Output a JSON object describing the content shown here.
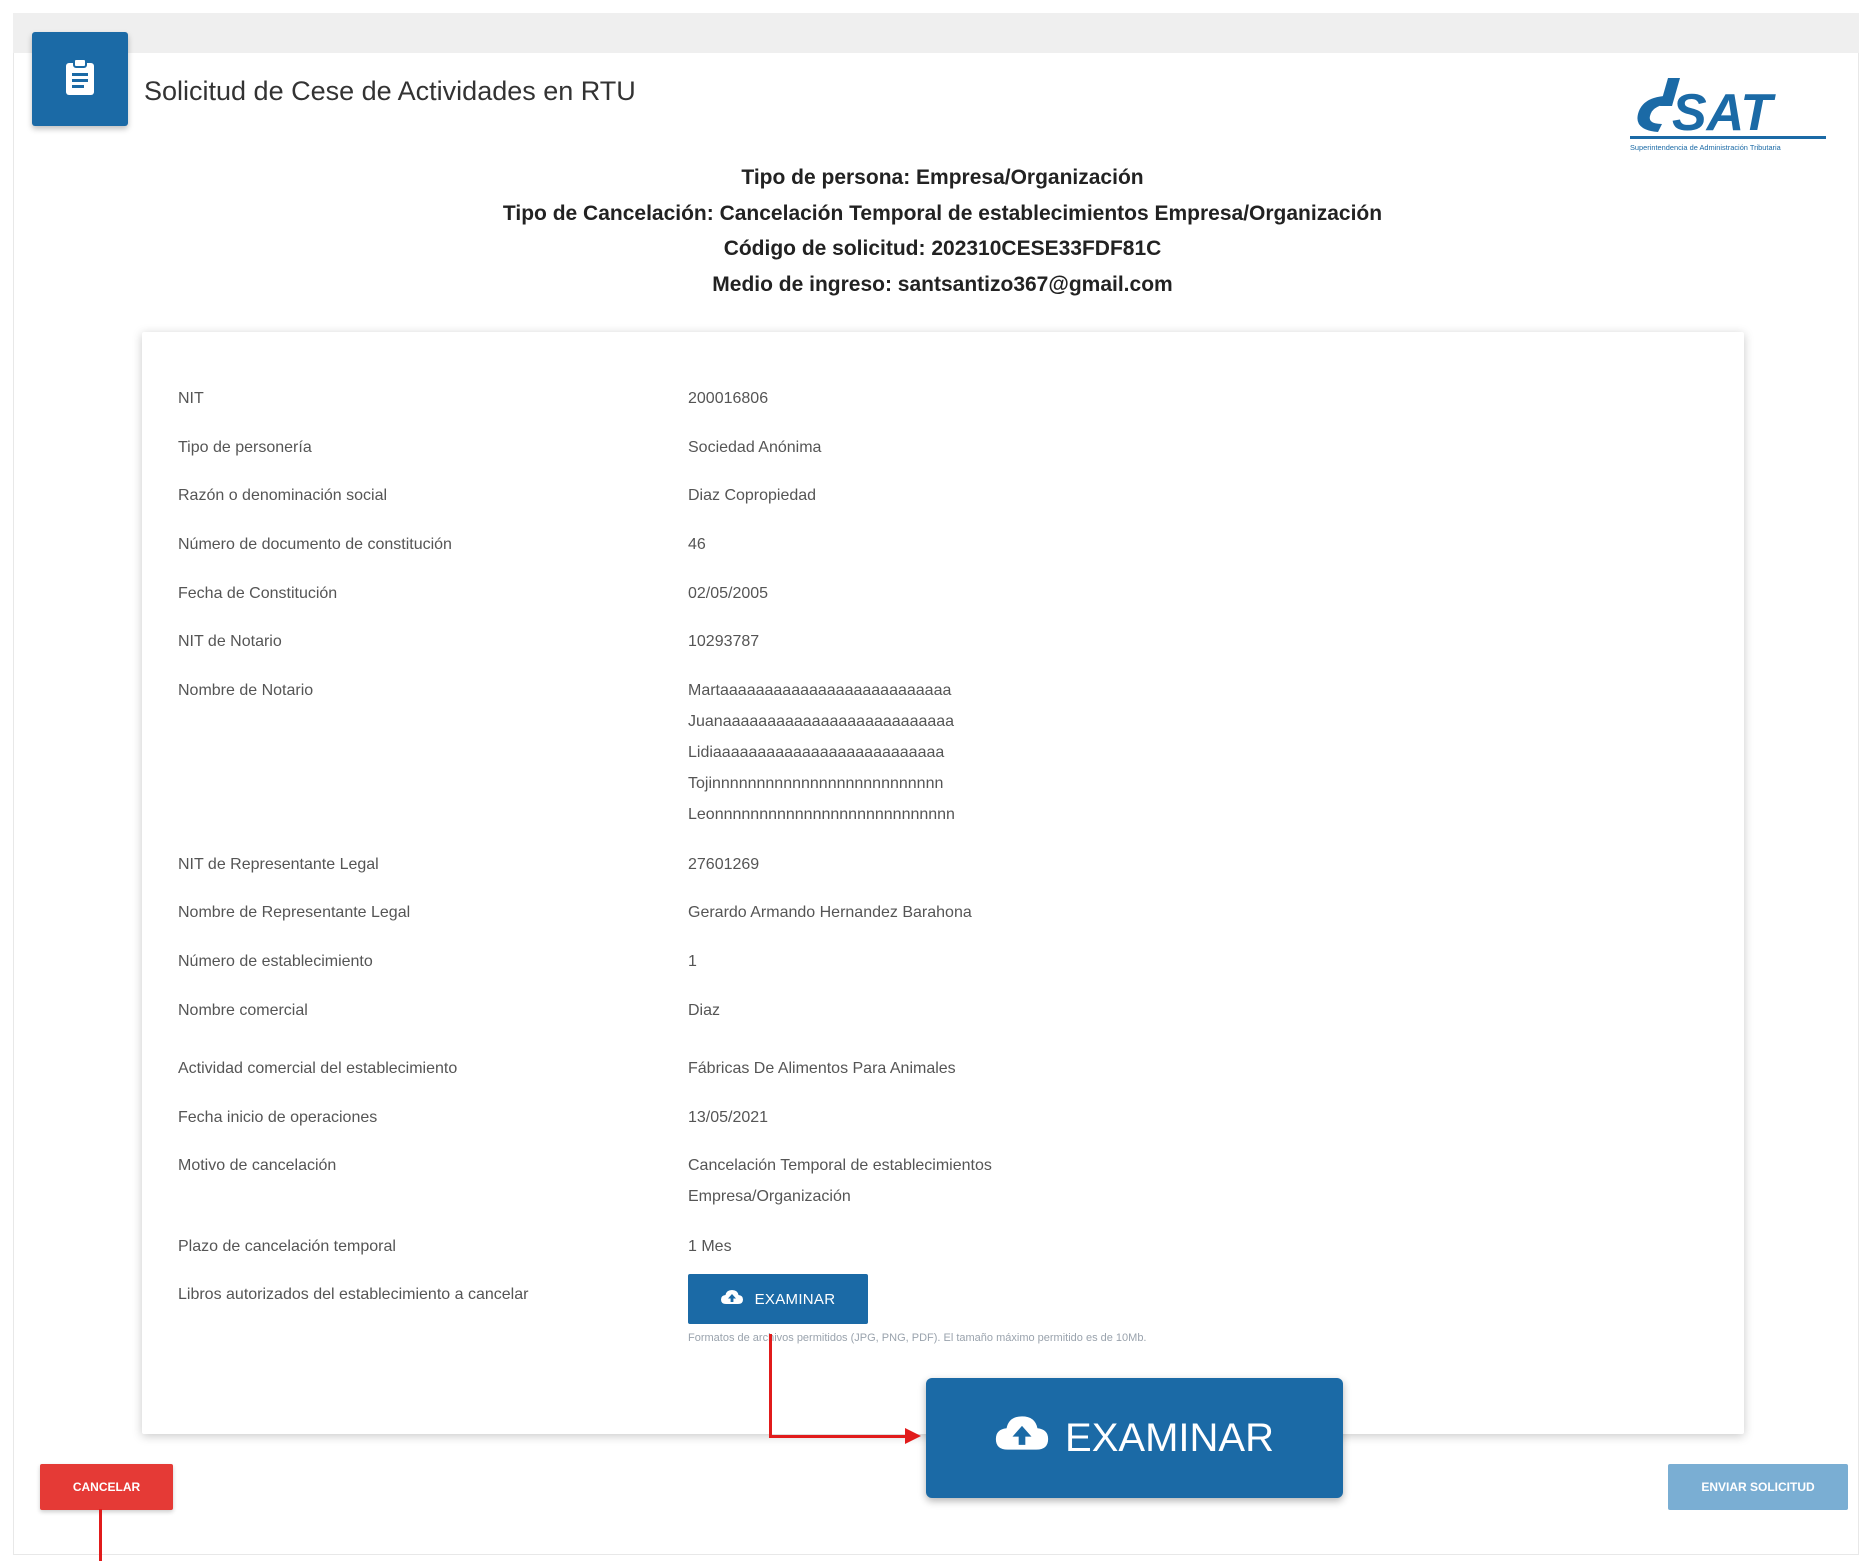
{
  "header": {
    "title": "Solicitud de Cese de Actividades en RTU",
    "icon": "clipboard-icon",
    "logo_text": "SAT",
    "logo_subtitle": "Superintendencia de Administración Tributaria"
  },
  "meta": {
    "tipo_persona": "Tipo de persona: Empresa/Organización",
    "tipo_cancelacion": "Tipo de Cancelación: Cancelación Temporal de establecimientos Empresa/Organización",
    "codigo": "Código de solicitud: 202310CESE33FDF81C",
    "medio": "Medio de ingreso: santsantizo367@gmail.com"
  },
  "fields": [
    {
      "label": "NIT",
      "value": "200016806"
    },
    {
      "label": "Tipo de personería",
      "value": "Sociedad Anónima"
    },
    {
      "label": "Razón o denominación social",
      "value": "Diaz Copropiedad"
    },
    {
      "label": "Número de documento de constitución",
      "value": "46"
    },
    {
      "label": "Fecha de Constitución",
      "value": "02/05/2005"
    },
    {
      "label": "NIT de Notario",
      "value": "10293787"
    },
    {
      "label": "Nombre de Notario",
      "value": "Martaaaaaaaaaaaaaaaaaaaaaaaaaa\nJuanaaaaaaaaaaaaaaaaaaaaaaaaaa\nLidiaaaaaaaaaaaaaaaaaaaaaaaaaa\nTojinnnnnnnnnnnnnnnnnnnnnnnnnn\nLeonnnnnnnnnnnnnnnnnnnnnnnnnnn"
    },
    {
      "label": "NIT de Representante Legal",
      "value": "27601269"
    },
    {
      "label": "Nombre de Representante Legal",
      "value": "Gerardo Armando Hernandez Barahona"
    },
    {
      "label": "Número de establecimiento",
      "value": "1"
    },
    {
      "label": "Nombre comercial",
      "value": "Diaz"
    },
    {
      "label": "Actividad comercial del establecimiento",
      "value": "Fábricas De Alimentos Para Animales"
    },
    {
      "label": "Fecha inicio de operaciones",
      "value": "13/05/2021"
    },
    {
      "label": "Motivo de cancelación",
      "value": "Cancelación Temporal de establecimientos\nEmpresa/Organización"
    },
    {
      "label": "Plazo de cancelación temporal",
      "value": "1 Mes"
    },
    {
      "label": "Libros autorizados del establecimiento a cancelar",
      "value": ""
    }
  ],
  "upload": {
    "button_label": "EXAMINAR",
    "icon": "cloud-upload-icon",
    "hint": "Formatos de archivos permitidos (JPG, PNG, PDF). El tamaño máximo permitido es de 10Mb."
  },
  "actions": {
    "cancel_label": "CANCELAR",
    "submit_label": "ENVIAR SOLICITUD"
  },
  "callout": {
    "label": "EXAMINAR"
  },
  "colors": {
    "primary": "#1b6aa6",
    "danger": "#e53a36",
    "submit_disabled": "#7aaed3",
    "annotation": "#e11b1b"
  }
}
